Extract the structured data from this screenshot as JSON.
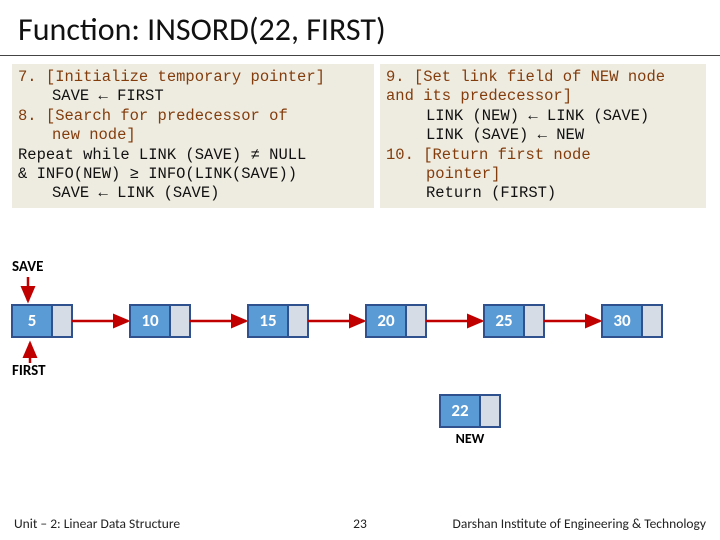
{
  "title": "Function: INSORD(22, FIRST)",
  "left_code": {
    "l1": "7. [Initialize temporary pointer]",
    "l2": "SAVE ← FIRST",
    "l3": "8. [Search for predecessor of",
    "l4": "new node]",
    "l5": "Repeat while LINK (SAVE) ≠ NULL",
    "l6": "& INFO(NEW) ≥ INFO(LINK(SAVE))",
    "l7": "SAVE ← LINK (SAVE)"
  },
  "right_code": {
    "l1": "9. [Set link field of NEW node and its predecessor]",
    "l2": "LINK (NEW) ← LINK (SAVE)",
    "l3": "LINK (SAVE) ← NEW",
    "l4": "10. [Return first node",
    "l5": "pointer]",
    "l6": "Return (FIRST)"
  },
  "labels": {
    "save": "SAVE",
    "first": "FIRST",
    "new": "NEW"
  },
  "nodes": [
    {
      "value": "5"
    },
    {
      "value": "10"
    },
    {
      "value": "15"
    },
    {
      "value": "20"
    },
    {
      "value": "25"
    },
    {
      "value": "30"
    }
  ],
  "new_node": {
    "value": "22"
  },
  "chart_data": {
    "type": "diagram",
    "description": "Singly linked list insertion in sorted order",
    "list": [
      5,
      10,
      15,
      20,
      25,
      30
    ],
    "new_value": 22,
    "save_pointer": "node 5 (FIRST)",
    "first_pointer": "node 5",
    "new_pointer": "node 22 (to be inserted between 20 and 25)"
  },
  "footer": {
    "left": "Unit – 2: Linear Data Structure",
    "center": "23",
    "right": "Darshan Institute of Engineering & Technology"
  },
  "colors": {
    "node_fill": "#5B9BD5",
    "node_border": "#2F528F",
    "link_fill": "#D6DCE5",
    "arrow": "#C00000"
  }
}
